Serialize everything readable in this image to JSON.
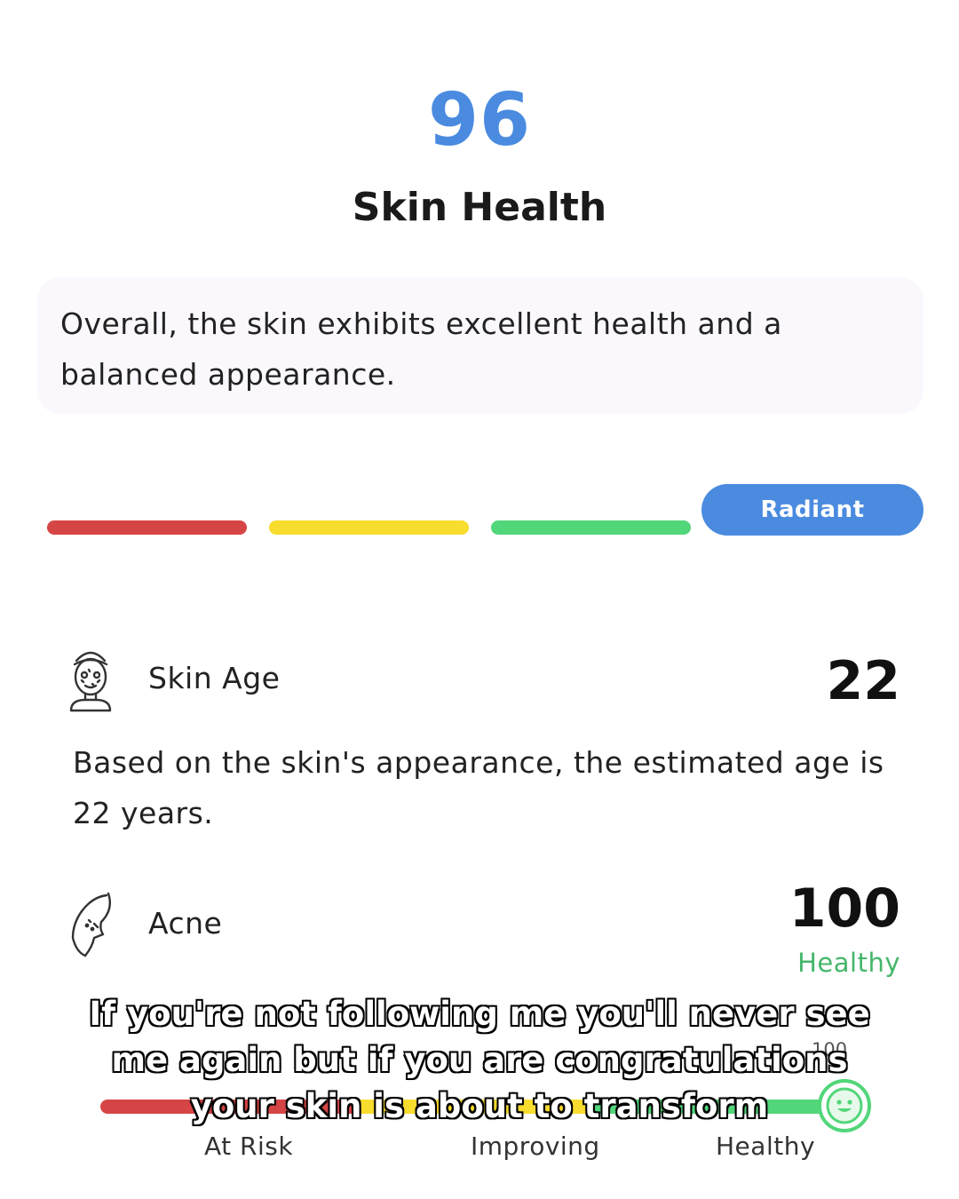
{
  "overall": {
    "score": "96",
    "title": "Skin Health",
    "summary": "Overall, the skin exhibits excellent health and a balanced appearance."
  },
  "level": {
    "selected_label": "Radiant",
    "colors": {
      "red": "#d64545",
      "yellow": "#f8dc2e",
      "green": "#52d67a",
      "blue": "#4a8be0"
    }
  },
  "metrics": {
    "skin_age": {
      "icon": "face-mask-icon",
      "label": "Skin Age",
      "value": "22",
      "description": "Based on the skin's appearance, the estimated age is 22 years."
    },
    "acne": {
      "icon": "face-profile-icon",
      "label": "Acne",
      "value": "100",
      "status": "Healthy",
      "scale": {
        "max_tick": "100",
        "labels": [
          "At Risk",
          "Improving",
          "Healthy"
        ],
        "marker_icon": "smiley-face-icon"
      }
    }
  },
  "caption": {
    "lines": [
      "If you're not following me you'll never see",
      "me again but if you are congratulations",
      "your skin is about to transform"
    ]
  }
}
